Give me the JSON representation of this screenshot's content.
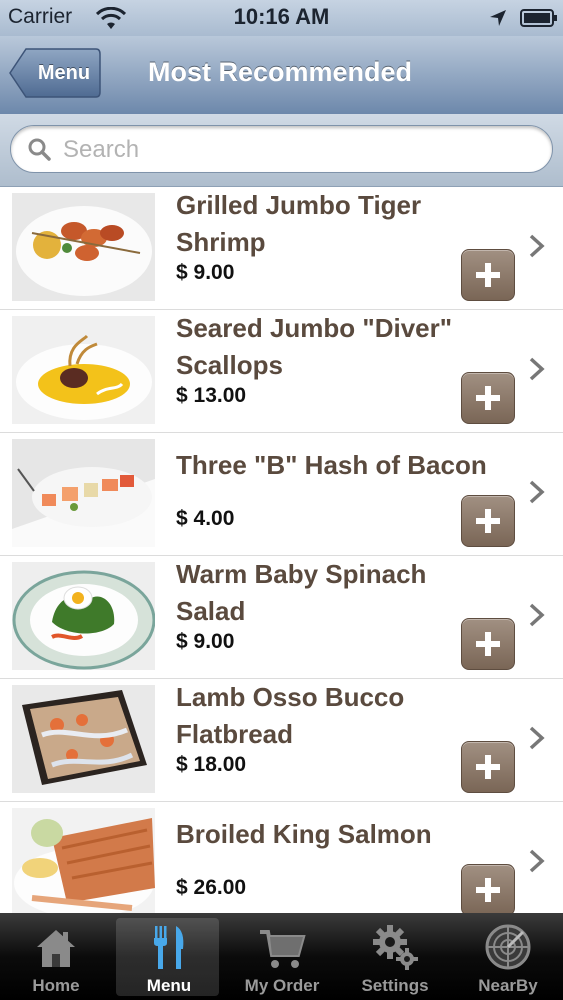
{
  "status_bar": {
    "carrier": "Carrier",
    "time": "10:16 AM"
  },
  "nav": {
    "back_label": "Menu",
    "title": "Most Recommended"
  },
  "search": {
    "placeholder": "Search",
    "value": ""
  },
  "items": [
    {
      "name_lines": [
        "Grilled Jumbo Tiger",
        "Shrimp"
      ],
      "price": "$ 9.00"
    },
    {
      "name_lines": [
        "Seared Jumbo \"Diver\"",
        "Scallops"
      ],
      "price": "$ 13.00"
    },
    {
      "name_lines": [
        "Three \"B\" Hash of Bacon"
      ],
      "price": "$ 4.00"
    },
    {
      "name_lines": [
        "Warm Baby Spinach",
        "Salad"
      ],
      "price": "$ 9.00"
    },
    {
      "name_lines": [
        "Lamb Osso Bucco",
        "Flatbread"
      ],
      "price": "$ 18.00"
    },
    {
      "name_lines": [
        "Broiled King Salmon"
      ],
      "price": "$ 26.00"
    }
  ],
  "tabs": [
    {
      "label": "Home",
      "icon": "home-icon",
      "active": false
    },
    {
      "label": "Menu",
      "icon": "fork-knife-icon",
      "active": true
    },
    {
      "label": "My Order",
      "icon": "cart-icon",
      "active": false
    },
    {
      "label": "Settings",
      "icon": "gear-icon",
      "active": false
    },
    {
      "label": "NearBy",
      "icon": "radar-icon",
      "active": false
    }
  ],
  "colors": {
    "dish_title": "#5a4a3e",
    "add_button": "#8a7565",
    "nav_bar": "#6d88ab"
  }
}
